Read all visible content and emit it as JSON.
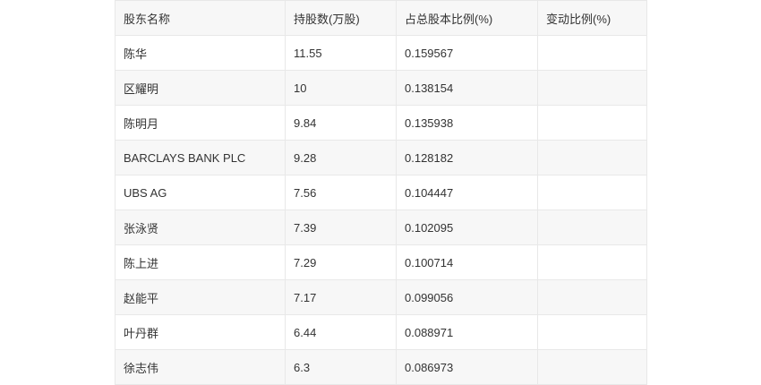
{
  "table": {
    "headers": [
      "股东名称",
      "持股数(万股)",
      "占总股本比例(%)",
      "变动比例(%)"
    ],
    "rows": [
      [
        "陈华",
        "11.55",
        "0.159567",
        ""
      ],
      [
        "区耀明",
        "10",
        "0.138154",
        ""
      ],
      [
        "陈明月",
        "9.84",
        "0.135938",
        ""
      ],
      [
        "BARCLAYS BANK PLC",
        "9.28",
        "0.128182",
        ""
      ],
      [
        "UBS AG",
        "7.56",
        "0.104447",
        ""
      ],
      [
        "张泳贤",
        "7.39",
        "0.102095",
        ""
      ],
      [
        "陈上进",
        "7.29",
        "0.100714",
        ""
      ],
      [
        "赵能平",
        "7.17",
        "0.099056",
        ""
      ],
      [
        "叶丹群",
        "6.44",
        "0.088971",
        ""
      ],
      [
        "徐志伟",
        "6.3",
        "0.086973",
        ""
      ]
    ]
  }
}
